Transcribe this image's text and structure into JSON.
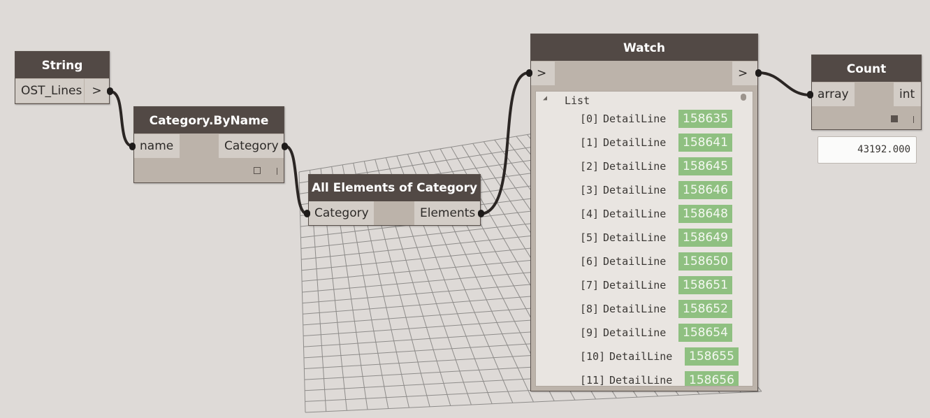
{
  "nodes": {
    "string": {
      "title": "String",
      "value": "OST_Lines",
      "output": ">"
    },
    "category_by_name": {
      "title": "Category.ByName",
      "input": "name",
      "output": "Category"
    },
    "all_elements": {
      "title": "All Elements of Category",
      "input": "Category",
      "output": "Elements"
    },
    "watch": {
      "title": "Watch",
      "input": ">",
      "output": ">",
      "list_label": "List",
      "items": [
        {
          "index": "[0]",
          "type": "DetailLine",
          "id": "158635"
        },
        {
          "index": "[1]",
          "type": "DetailLine",
          "id": "158641"
        },
        {
          "index": "[2]",
          "type": "DetailLine",
          "id": "158645"
        },
        {
          "index": "[3]",
          "type": "DetailLine",
          "id": "158646"
        },
        {
          "index": "[4]",
          "type": "DetailLine",
          "id": "158648"
        },
        {
          "index": "[5]",
          "type": "DetailLine",
          "id": "158649"
        },
        {
          "index": "[6]",
          "type": "DetailLine",
          "id": "158650"
        },
        {
          "index": "[7]",
          "type": "DetailLine",
          "id": "158651"
        },
        {
          "index": "[8]",
          "type": "DetailLine",
          "id": "158652"
        },
        {
          "index": "[9]",
          "type": "DetailLine",
          "id": "158654"
        },
        {
          "index": "[10]",
          "type": "DetailLine",
          "id": "158655"
        },
        {
          "index": "[11]",
          "type": "DetailLine",
          "id": "158656"
        }
      ]
    },
    "count": {
      "title": "Count",
      "input": "array",
      "output": "int",
      "result": "43192.000"
    }
  },
  "colors": {
    "canvas": "#dedad7",
    "node_header": "#524945",
    "node_body": "#bcb3aa",
    "port": "#d3cdc7",
    "id_highlight": "#8fc081",
    "wire": "#2b2624"
  }
}
